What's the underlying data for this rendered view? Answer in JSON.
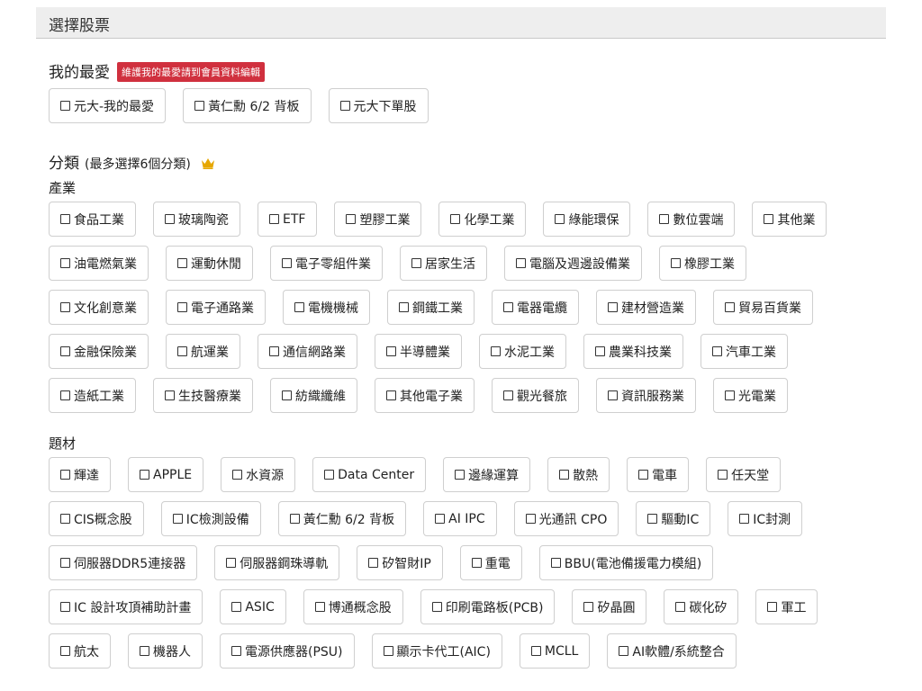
{
  "window": {
    "title": "選擇股票"
  },
  "favorites": {
    "heading": "我的最愛",
    "badge": "維護我的最愛請到會員資料編輯",
    "items": [
      "元大-我的最愛",
      "黃仁勳 6/2 背板",
      "元大下單股"
    ]
  },
  "categories": {
    "heading": "分類",
    "note": "(最多選擇6個分類)",
    "crown_color": "#e6a700",
    "industry": {
      "heading": "產業",
      "rows": [
        [
          "食品工業",
          "玻璃陶瓷",
          "ETF",
          "塑膠工業",
          "化學工業",
          "綠能環保",
          "數位雲端",
          "其他業"
        ],
        [
          "油電燃氣業",
          "運動休閒",
          "電子零組件業",
          "居家生活",
          "電腦及週邊設備業",
          "橡膠工業"
        ],
        [
          "文化創意業",
          "電子通路業",
          "電機機械",
          "鋼鐵工業",
          "電器電纜",
          "建材營造業",
          "貿易百貨業"
        ],
        [
          "金融保險業",
          "航運業",
          "通信網路業",
          "半導體業",
          "水泥工業",
          "農業科技業",
          "汽車工業"
        ],
        [
          "造紙工業",
          "生技醫療業",
          "紡織纖維",
          "其他電子業",
          "觀光餐旅",
          "資訊服務業",
          "光電業"
        ]
      ]
    },
    "themes": {
      "heading": "題材",
      "rows": [
        [
          "輝達",
          "APPLE",
          "水資源",
          "Data Center",
          "邊緣運算",
          "散熱",
          "電車",
          "任天堂"
        ],
        [
          "CIS概念股",
          "IC檢測設備",
          "黃仁勳 6/2 背板",
          "AI IPC",
          "光通訊 CPO",
          "驅動IC",
          "IC封測"
        ],
        [
          "伺服器DDR5連接器",
          "伺服器鋼珠導軌",
          "矽智財IP",
          "重電",
          "BBU(電池備援電力模組)"
        ],
        [
          "IC 設計攻頂補助計畫",
          "ASIC",
          "博通概念股",
          "印刷電路板(PCB)",
          "矽晶圓",
          "碳化矽",
          "軍工"
        ],
        [
          "航太",
          "機器人",
          "電源供應器(PSU)",
          "顯示卡代工(AIC)",
          "MCLL",
          "AI軟體/系統整合"
        ]
      ]
    }
  },
  "colors": {
    "badge": "#d0303e",
    "chip_border": "#cfcfcf",
    "titlebar": "#eeeeee"
  }
}
